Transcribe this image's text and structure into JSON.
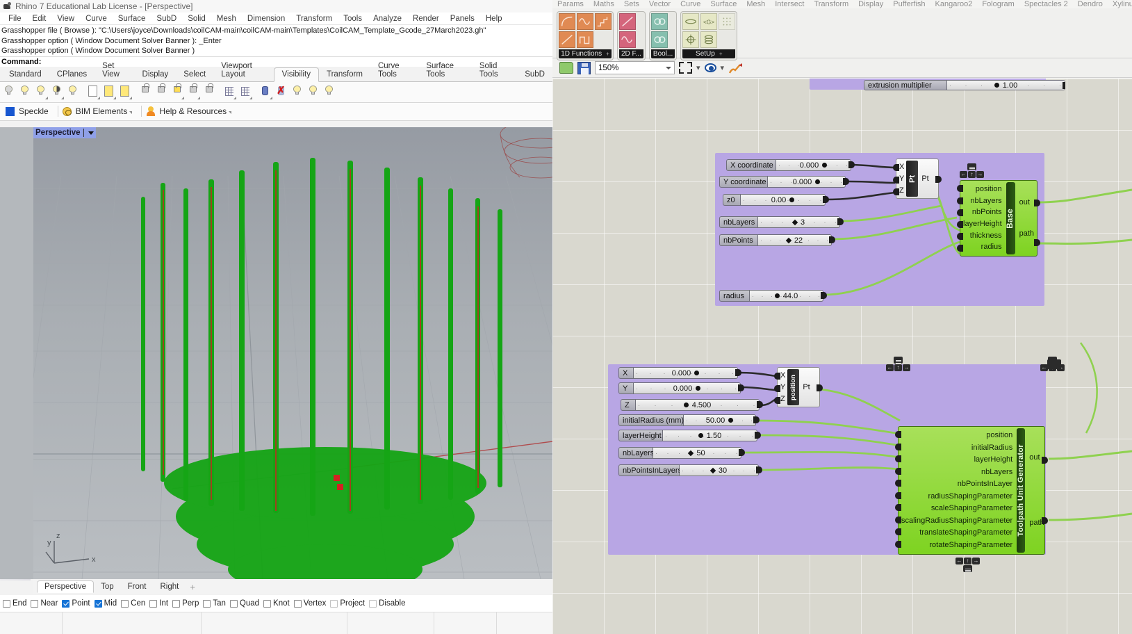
{
  "rhino": {
    "title": "Rhino 7 Educational Lab License - [Perspective]",
    "menu": [
      "File",
      "Edit",
      "View",
      "Curve",
      "Surface",
      "SubD",
      "Solid",
      "Mesh",
      "Dimension",
      "Transform",
      "Tools",
      "Analyze",
      "Render",
      "Panels",
      "Help"
    ],
    "command_history": [
      "Grasshopper file ( Browse ): \"C:\\Users\\joyce\\Downloads\\coilCAM-main\\coilCAM-main\\Templates\\CoilCAM_Template_Gcode_27March2023.gh\"",
      "Grasshopper option ( Window  Document  Solver  Banner ): _Enter",
      "Grasshopper option ( Window  Document  Solver  Banner )"
    ],
    "command_prompt": "Command:",
    "toolbar_tabs": [
      {
        "label": "Standard",
        "active": false
      },
      {
        "label": "CPlanes",
        "active": false
      },
      {
        "label": "Set View",
        "active": false
      },
      {
        "label": "Display",
        "active": false
      },
      {
        "label": "Select",
        "active": false
      },
      {
        "label": "Viewport Layout",
        "active": false
      },
      {
        "label": "Visibility",
        "active": true
      },
      {
        "label": "Transform",
        "active": false
      },
      {
        "label": "Curve Tools",
        "active": false
      },
      {
        "label": "Surface Tools",
        "active": false
      },
      {
        "label": "Solid Tools",
        "active": false
      },
      {
        "label": "SubD",
        "active": false
      }
    ],
    "plugin_bar": [
      {
        "label": "Speckle",
        "icon": "speckle-square-icon"
      },
      {
        "label": "BIM Elements",
        "icon": "bim-globe-icon"
      },
      {
        "label": "Help & Resources",
        "icon": "help-person-icon"
      }
    ],
    "viewport": {
      "label": "Perspective",
      "axis": {
        "x": "x",
        "y": "y",
        "z": "z"
      },
      "tabs": [
        {
          "label": "Perspective",
          "active": true
        },
        {
          "label": "Top",
          "active": false
        },
        {
          "label": "Front",
          "active": false
        },
        {
          "label": "Right",
          "active": false
        }
      ],
      "add_tab": "+"
    },
    "osnaps": [
      {
        "label": "End",
        "on": false,
        "dim": false
      },
      {
        "label": "Near",
        "on": false,
        "dim": false
      },
      {
        "label": "Point",
        "on": true,
        "dim": false
      },
      {
        "label": "Mid",
        "on": true,
        "dim": false
      },
      {
        "label": "Cen",
        "on": false,
        "dim": false
      },
      {
        "label": "Int",
        "on": false,
        "dim": false
      },
      {
        "label": "Perp",
        "on": false,
        "dim": false
      },
      {
        "label": "Tan",
        "on": false,
        "dim": false
      },
      {
        "label": "Quad",
        "on": false,
        "dim": false
      },
      {
        "label": "Knot",
        "on": false,
        "dim": false
      },
      {
        "label": "Vertex",
        "on": false,
        "dim": false
      },
      {
        "label": "Project",
        "on": false,
        "dim": true
      },
      {
        "label": "Disable",
        "on": false,
        "dim": true
      }
    ]
  },
  "grasshopper": {
    "menu": [
      "Params",
      "Maths",
      "Sets",
      "Vector",
      "Curve",
      "Surface",
      "Mesh",
      "Intersect",
      "Transform",
      "Display",
      "Pufferfish",
      "Kangaroo2",
      "Fologram",
      "Spectacles 2",
      "Dendro",
      "Xylinus"
    ],
    "ribbon_groups": [
      {
        "label": "1D Functions",
        "pin": "+",
        "swatch": "#e08a53",
        "icons": [
          "curve-ease-icon",
          "sine-wave-icon",
          "step-function-icon",
          "linear-ramp-icon",
          "square-wave-icon"
        ]
      },
      {
        "label": "2D F...",
        "pin": "",
        "swatch": "#d4657c",
        "icons": [
          "diagonal-line-icon",
          "sine-2d-icon"
        ]
      },
      {
        "label": "Bool...",
        "pin": "",
        "swatch": "#86bfae",
        "icons": [
          "infinity-loop-icon",
          "infinity-loop-alt-icon"
        ]
      },
      {
        "label": "SetUp",
        "pin": "+",
        "swatch": "#e6e8c6",
        "icons": [
          "ellipse-icon",
          "gcode-icon",
          "grid-dots-icon",
          "target-icon",
          "stack-icon"
        ]
      }
    ],
    "toolbar": {
      "open_label": "open-file-icon",
      "save_label": "save-file-icon",
      "zoom_value": "150%",
      "zoom_extents": "zoom-extents-icon",
      "preview": "preview-eye-icon",
      "paint": "paint-icon"
    },
    "top_clipped_slider": {
      "name": "extrusion multiplier",
      "value": "1.00"
    },
    "base_group": {
      "sliders": [
        {
          "name": "X coordinate",
          "value": "0.000",
          "knob": "round",
          "fill": 0.52
        },
        {
          "name": "Y coordinate",
          "value": "0.000",
          "knob": "round",
          "fill": 0.52
        },
        {
          "name": "z0",
          "value": "0.00",
          "knob": "round",
          "fill": 0.5
        },
        {
          "name": "nbLayers",
          "value": "3",
          "knob": "diamond",
          "fill": 0.4
        },
        {
          "name": "nbPoints",
          "value": "22",
          "knob": "diamond",
          "fill": 0.38
        },
        {
          "name": "radius",
          "value": "44.0",
          "knob": "round",
          "fill": 0.48
        }
      ],
      "point_node": {
        "inputs": [
          "X",
          "Y",
          "Z"
        ],
        "name": "Pt",
        "output": "Pt"
      },
      "cluster": {
        "name": "Base",
        "inputs": [
          "position",
          "nbLayers",
          "nbPoints",
          "layerHeight",
          "thickness",
          "radius"
        ],
        "outputs": [
          "out",
          "path"
        ]
      }
    },
    "toolpath_group": {
      "sliders": [
        {
          "name": "X",
          "value": "0.000",
          "knob": "round",
          "fill": 0.5
        },
        {
          "name": "Y",
          "value": "0.000",
          "knob": "round",
          "fill": 0.52
        },
        {
          "name": "Z",
          "value": "4.500",
          "knob": "round",
          "fill": 0.32
        },
        {
          "name": "initialRadius (mm)",
          "value": "50.00",
          "knob": "round",
          "fill": 0.8
        },
        {
          "name": "layerHeight",
          "value": "1.50",
          "knob": "round",
          "fill": 0.36
        },
        {
          "name": "nbLayers",
          "value": "50",
          "knob": "diamond",
          "fill": 0.3
        },
        {
          "name": "nbPointsInLayers",
          "value": "30",
          "knob": "diamond",
          "fill": 0.32
        }
      ],
      "point_node": {
        "inputs": [
          "X",
          "Y",
          "Z"
        ],
        "name": "position",
        "output": "Pt"
      },
      "cluster": {
        "name": "Toolpath Unit Generator",
        "inputs": [
          "position",
          "initialRadius",
          "layerHeight",
          "nbLayers",
          "nbPointsInLayer",
          "radiusShapingParameter",
          "scaleShapingParameter",
          "scalingRadiusShapingParameter",
          "translateShapingParameter",
          "rotateShapingParameter"
        ],
        "outputs": [
          "out",
          "path"
        ]
      }
    },
    "hud_buttons": [
      "menu-icon",
      "left-arrow-icon",
      "up-arrow-icon",
      "right-arrow-icon"
    ]
  },
  "colors": {
    "group_purple": "#b8a6e4",
    "cluster_green": "#7ed321",
    "wire_green": "#8fd14f",
    "wire_dark": "#2b2b2b",
    "viewport_bg": "#b4b8bc",
    "point_green": "#16a916",
    "accent_blue": "#1573d6"
  }
}
